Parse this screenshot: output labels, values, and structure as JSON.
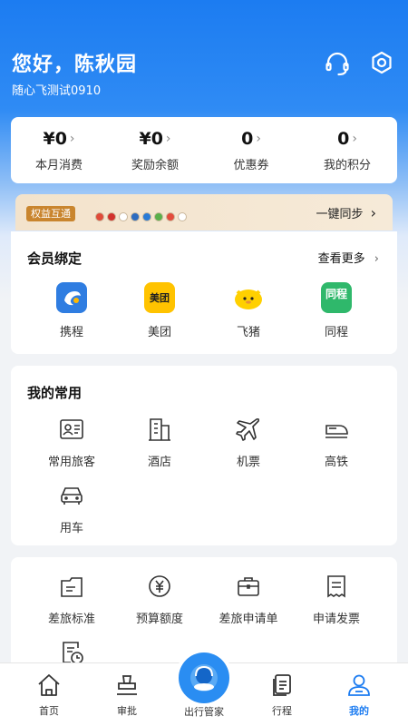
{
  "header": {
    "greeting": "您好，陈秋园",
    "subtitle": "随心飞测试0910",
    "icons": [
      "headset-icon",
      "settings-gear-icon"
    ]
  },
  "stats": [
    {
      "value": "¥0",
      "label": "本月消费"
    },
    {
      "value": "¥0",
      "label": "奖励余额"
    },
    {
      "value": "0",
      "label": "优惠券"
    },
    {
      "value": "0",
      "label": "我的积分"
    }
  ],
  "benefit_bar": {
    "tag": "权益互通",
    "action": "一键同步",
    "chevron": "›"
  },
  "member_binding": {
    "title": "会员绑定",
    "more": "查看更多",
    "apps": [
      {
        "label": "携程",
        "icon": "ctrip-logo",
        "color": "#2f7de1"
      },
      {
        "label": "美团",
        "icon": "meituan-logo",
        "color": "#ffc300",
        "logo_text": "美团"
      },
      {
        "label": "飞猪",
        "icon": "fliggy-logo",
        "color": "#ffd000"
      },
      {
        "label": "同程",
        "icon": "tongcheng-logo",
        "color": "#2fb86b",
        "logo_text": "同程"
      }
    ]
  },
  "common": {
    "title": "我的常用",
    "items": [
      {
        "label": "常用旅客",
        "icon": "traveler-card-icon"
      },
      {
        "label": "酒店",
        "icon": "hotel-icon"
      },
      {
        "label": "机票",
        "icon": "airplane-icon"
      },
      {
        "label": "高铁",
        "icon": "train-icon"
      },
      {
        "label": "用车",
        "icon": "car-icon"
      }
    ]
  },
  "tools": {
    "items": [
      {
        "label": "差旅标准",
        "icon": "policy-icon"
      },
      {
        "label": "预算额度",
        "icon": "budget-icon"
      },
      {
        "label": "差旅申请单",
        "icon": "briefcase-icon"
      },
      {
        "label": "申请发票",
        "icon": "invoice-icon"
      }
    ]
  },
  "tabbar": {
    "tabs": [
      {
        "label": "首页",
        "icon": "home-icon"
      },
      {
        "label": "审批",
        "icon": "approval-icon"
      },
      {
        "label": "出行管家",
        "icon": "butler-icon"
      },
      {
        "label": "行程",
        "icon": "itinerary-icon"
      },
      {
        "label": "我的",
        "icon": "profile-icon"
      }
    ],
    "active_color": "#1c7cf1"
  }
}
